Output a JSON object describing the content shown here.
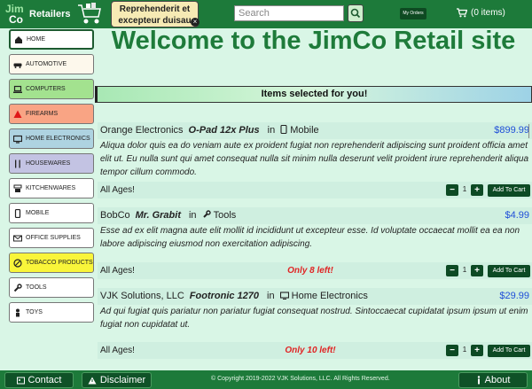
{
  "header": {
    "logo_line1": "Jim",
    "logo_line2": "Co",
    "brand": "Retailers",
    "promo_text": "Reprehenderit et excepteur duisau",
    "promo_close": "×",
    "search_placeholder": "Search",
    "orders_label": "My Orders",
    "cart_label": "(0 items)"
  },
  "sidebar": {
    "items": [
      {
        "label": "HOME",
        "icon": "home-icon",
        "bg": "#ffffff"
      },
      {
        "label": "AUTOMOTIVE",
        "icon": "car-icon",
        "bg": "#fdf8ec"
      },
      {
        "label": "COMPUTERS",
        "icon": "laptop-icon",
        "bg": "#a3e28f"
      },
      {
        "label": "FIREARMS",
        "icon": "warning-icon",
        "bg": "#f9a484"
      },
      {
        "label": "HOME ELECTRONICS",
        "icon": "tv-icon",
        "bg": "#aed3e1"
      },
      {
        "label": "HOUSEWARES",
        "icon": "utensils-icon",
        "bg": "#c3c3e3"
      },
      {
        "label": "KITCHENWARES",
        "icon": "blender-icon",
        "bg": "#ffffff"
      },
      {
        "label": "MOBILE",
        "icon": "mobile-icon",
        "bg": "#ffffff"
      },
      {
        "label": "OFFICE SUPPLIES",
        "icon": "envelope-icon",
        "bg": "#ffffff"
      },
      {
        "label": "TOBACCO PRODUCTS",
        "icon": "no-smoking-icon",
        "bg": "#f9f53a"
      },
      {
        "label": "TOOLS",
        "icon": "wrench-icon",
        "bg": "#ffffff"
      },
      {
        "label": "TOYS",
        "icon": "person-icon",
        "bg": "#ffffff"
      }
    ]
  },
  "main": {
    "title": "Welcome to the JimCo Retail site",
    "section_title": "Items selected for you!"
  },
  "products": [
    {
      "maker": "Orange Electronics",
      "name": "O-Pad 12x Plus",
      "in_label": "in",
      "category": "Mobile",
      "price": "$899.99",
      "description": "Aliqua dolor quis ea do veniam aute ex proident fugiat non reprehenderit adipiscing sunt proident officia amet elit ut. Eu nulla sunt qui amet consequat nulla sit minim nulla deserunt velit proident irure reprehenderit aliqua tempor cillum commodo.",
      "age": "All Ages!",
      "stock": "",
      "qty": "1",
      "add_label": "Add To Cart"
    },
    {
      "maker": "BobCo",
      "name": "Mr. Grabit",
      "in_label": "in",
      "category": "Tools",
      "price": "$4.99",
      "description": "Esse ad ex elit magna aute elit mollit id incididunt ut excepteur esse. Id voluptate occaecat mollit ea ea non labore adipiscing eiusmod non exercitation adipiscing.",
      "age": "All Ages!",
      "stock": "Only 8 left!",
      "qty": "1",
      "add_label": "Add To Cart"
    },
    {
      "maker": "VJK Solutions, LLC",
      "name": "Footronic 1270",
      "in_label": "in",
      "category": "Home Electronics",
      "price": "$29.99",
      "description": "Ad qui fugiat quis pariatur non pariatur fugiat consequat nostrud. Sintoccaecat cupidatat ipsum ipsum ut enim fugiat non cupidatat ut.",
      "age": "All Ages!",
      "stock": "Only 10 left!",
      "qty": "1",
      "add_label": "Add To Cart"
    }
  ],
  "footer": {
    "contact_label": "Contact",
    "disclaimer_label": "Disclaimer",
    "copyright": "© Copyright 2019-2022 VJK Solutions, LLC. All Rights Reserved.",
    "about_label": "About"
  },
  "colors": {
    "header_bg": "#1d7a3a",
    "page_bg": "#d9f6e6",
    "title": "#1e7b3a",
    "price": "#1f4fd8",
    "stock_warning": "#e02424",
    "button_dark": "#0d4a24"
  }
}
